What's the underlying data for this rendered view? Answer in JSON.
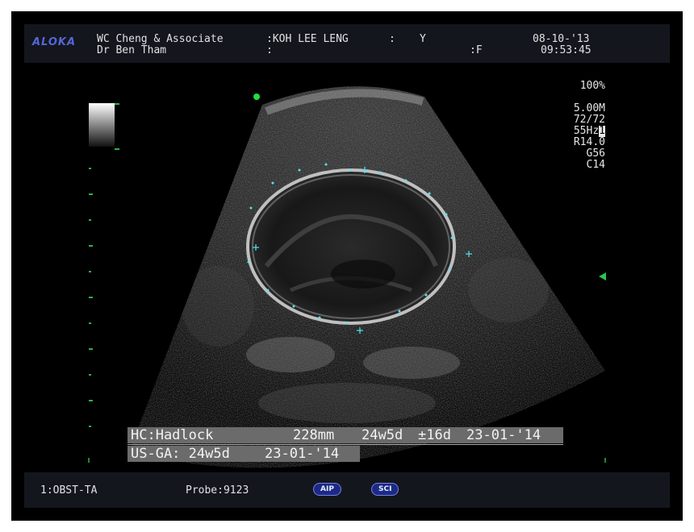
{
  "header": {
    "logo": "ALOKA",
    "clinic": "WC Cheng & Associate",
    "patient_label": ":KOH LEE LENG",
    "sep1": ":",
    "age": "Y",
    "doctor": "Dr Ben Tham",
    "sep2": ":",
    "sex": ":F",
    "date": "08-10-'13",
    "time": "09:53:45"
  },
  "params": {
    "zoom": "100%",
    "frequency": "5.00M",
    "frame": "72/72",
    "frame_rate_prefix": "55Hz",
    "frame_rate_box": "1",
    "range": "R14.0",
    "gain": "G56",
    "contrast": "C14"
  },
  "measurements": {
    "hc_method": "HC:Hadlock",
    "hc_value": "228mm",
    "hc_ga": "24w5d",
    "hc_sd": "±16d",
    "hc_edd": "23-01-'14",
    "usga_label": "US-GA: 24w5d",
    "usga_edd": "23-01-'14"
  },
  "footer": {
    "mode": "1:OBST-TA",
    "probe": "Probe:9123",
    "aip_button": "AIP",
    "sci_button": "SCI"
  },
  "colors": {
    "logo": "#5566d8",
    "marker_green": "#2bb24a",
    "caliper_cyan": "#4fe6f0",
    "badge_blue": "#1c2a86"
  },
  "icons": [
    "focus-marker-icon",
    "grayscale-bar",
    "caliper-cross-icon"
  ]
}
